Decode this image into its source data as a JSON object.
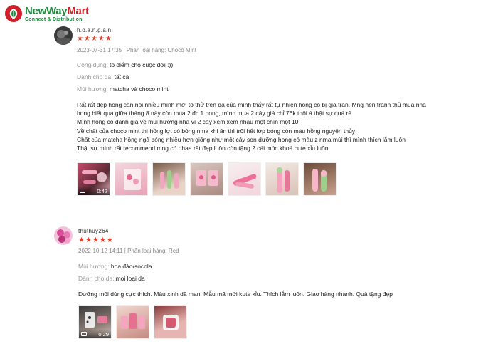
{
  "brand": {
    "name_part1": "NewWay",
    "name_part2": "Mart",
    "tagline": "Connect & Distribution",
    "colors": {
      "green": "#1e8a3c",
      "red": "#d1202c"
    }
  },
  "rating_color": "#e8412b",
  "reviews": [
    {
      "username": "h.o.a.n.g.a.n",
      "stars": 5,
      "meta": "2023-07-31 17:35 | Phân loại hàng: Choco Mint",
      "attributes": [
        {
          "label": "Công dụng:",
          "value": "tô điểm cho cuộc đời :))"
        },
        {
          "label": "Dành cho da:",
          "value": "tất cả"
        },
        {
          "label": "Mùi hương:",
          "value": "matcha và choco mint"
        }
      ],
      "body_lines": [
        "Rất rất đẹp hong cần nói nhiều mình mới tô thử trên da của mình thấy rất tự nhiên hong có bị giả trân. Mng nên tranh thủ mua nha",
        "hong biết qua giữa tháng 8 này còn mua 2 đc 1 hong, mình mua 2 cây giá chỉ 76k thôi á thật sự quá rẻ",
        "Mình hong có đánh giá về mùi hương nha vì 2 cây xem xem nhau một chín một 10",
        "Về chất của choco mint thì hồng lợt có bóng nma khi ăn thì trôi hết lớp bóng còn màu hồng nguyên thủy",
        "Chất của matcha hồng ngả bóng nhiều hơn giống như một cây son dưỡng hong có màu z nma mùi thì mình thích lắm luôn",
        "Thật sự mình rất recommend mng có nhaa rất đẹp luôn còn tặng 2 cái móc khoá cute xỉu luôn"
      ],
      "media": [
        {
          "type": "video",
          "duration": "0:42"
        },
        {
          "type": "image"
        },
        {
          "type": "image"
        },
        {
          "type": "image"
        },
        {
          "type": "image"
        },
        {
          "type": "image"
        },
        {
          "type": "image"
        }
      ]
    },
    {
      "username": "thuthuy264",
      "stars": 5,
      "meta": "2022-10-12 14:11 | Phân loại hàng: Red",
      "attributes": [
        {
          "label": "Mùi hương:",
          "value": "hoa đào/socola"
        },
        {
          "label": "Dành cho da:",
          "value": "mọi loại da"
        }
      ],
      "body_lines": [
        "Dưỡng môi dùng cực thích. Màu xinh dã man. Mẫu mã mới kute xỉu. Thích lắm luôn. Giao hàng nhanh. Quà tặng đẹp"
      ],
      "media": [
        {
          "type": "video",
          "duration": "0:29"
        },
        {
          "type": "image"
        },
        {
          "type": "image"
        }
      ]
    }
  ]
}
